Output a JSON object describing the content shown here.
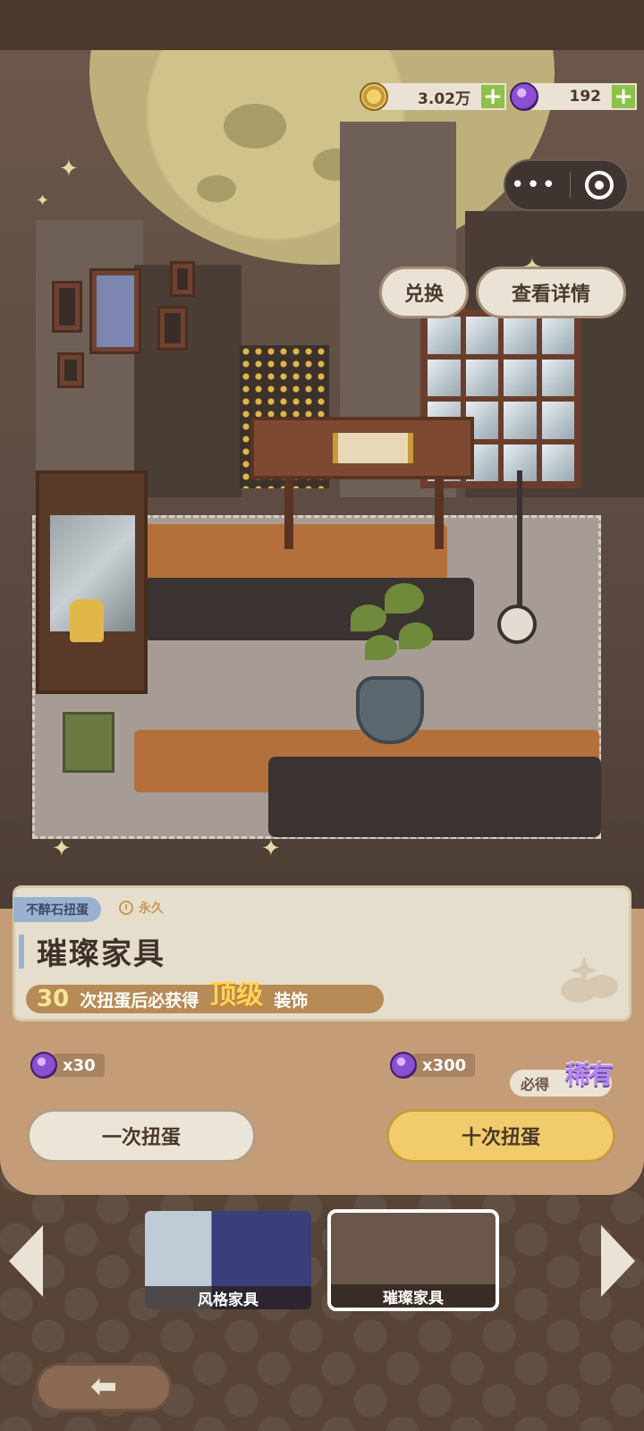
{
  "currencies": {
    "coins": {
      "value": "3.02万",
      "icon": "coin-icon"
    },
    "gems": {
      "value": "192",
      "icon": "purple-gem-icon"
    }
  },
  "capsule": {
    "more_icon": "•••",
    "target_icon": "target-icon"
  },
  "actions": {
    "exchange_label": "兑换",
    "details_label": "查看详情"
  },
  "pool": {
    "type_tag": "不醉石扭蛋",
    "duration": "永久",
    "title": "璀璨家具",
    "guarantee": {
      "count": "30",
      "text_before": "次扭蛋后必获得",
      "highlight": "顶级",
      "text_after": "装饰"
    }
  },
  "draw": {
    "single": {
      "cost": "x30",
      "label": "一次扭蛋"
    },
    "ten": {
      "cost": "x300",
      "label": "十次扭蛋",
      "badge": "必得",
      "badge_highlight": "稀有"
    }
  },
  "pools": [
    {
      "label": "风格家具",
      "selected": false
    },
    {
      "label": "璀璨家具",
      "selected": true
    }
  ],
  "colors": {
    "accent_gold": "#f1cb6c",
    "plus_green": "#8dc14a",
    "tag_blue": "#9ab2cf"
  }
}
